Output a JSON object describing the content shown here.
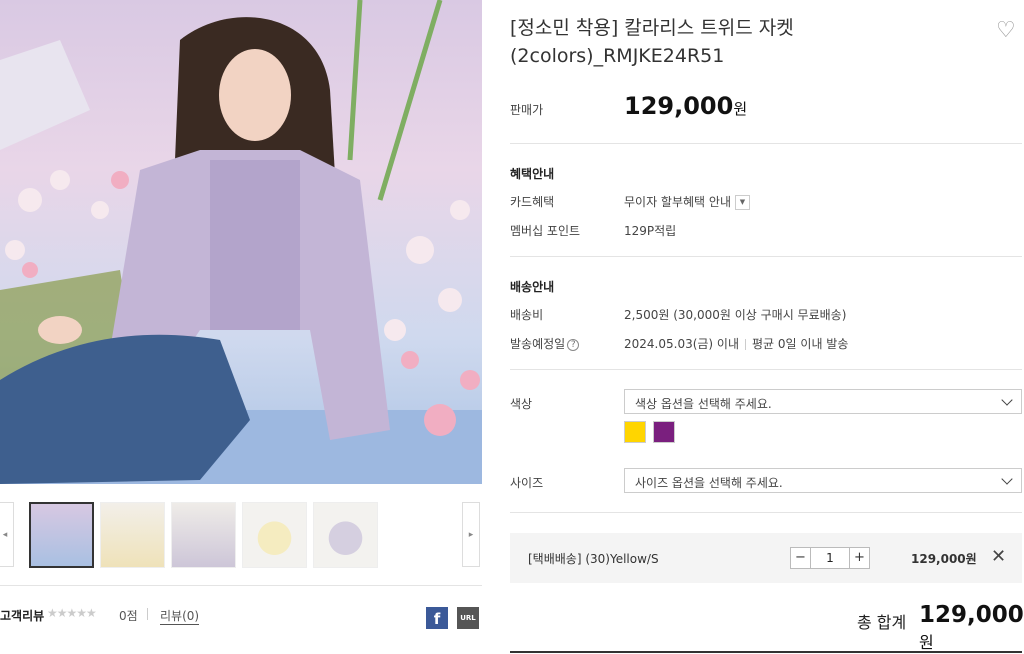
{
  "product": {
    "title": "[정소민 착용] 칼라리스 트위드 자켓(2colors)_RMJKE24R51",
    "price_label": "판매가",
    "price": "129,000",
    "price_unit": "원"
  },
  "benefits": {
    "title": "혜택안내",
    "card_label": "카드혜택",
    "card_value": "무이자 할부혜택 안내",
    "point_label": "멤버십 포인트",
    "point_value": "129P적립"
  },
  "delivery": {
    "title": "배송안내",
    "fee_label": "배송비",
    "fee_value": "2,500원 (30,000원 이상 구매시 무료배송)",
    "ship_label": "발송예정일",
    "ship_date": "2024.05.03(금) 이내",
    "ship_avg": "평균 0일 이내 발송"
  },
  "options": {
    "color_label": "색상",
    "color_placeholder": "색상 옵션을 선택해 주세요.",
    "swatches": [
      "#ffd500",
      "#7a1f7e"
    ],
    "size_label": "사이즈",
    "size_placeholder": "사이즈 옵션을 선택해 주세요."
  },
  "selected": {
    "name": "[택배배송] (30)Yellow/S",
    "qty": "1",
    "price": "129,000원"
  },
  "total": {
    "label": "총 합계",
    "value": "129,000",
    "unit": "원"
  },
  "reviews": {
    "title": "고객리뷰",
    "stars": "★★★★★",
    "score": "0점",
    "link": "리뷰(0)"
  },
  "share": {
    "facebook": "f",
    "url": "URL"
  },
  "icons": {
    "wishlist": "heart-icon",
    "remove": "close-icon"
  }
}
